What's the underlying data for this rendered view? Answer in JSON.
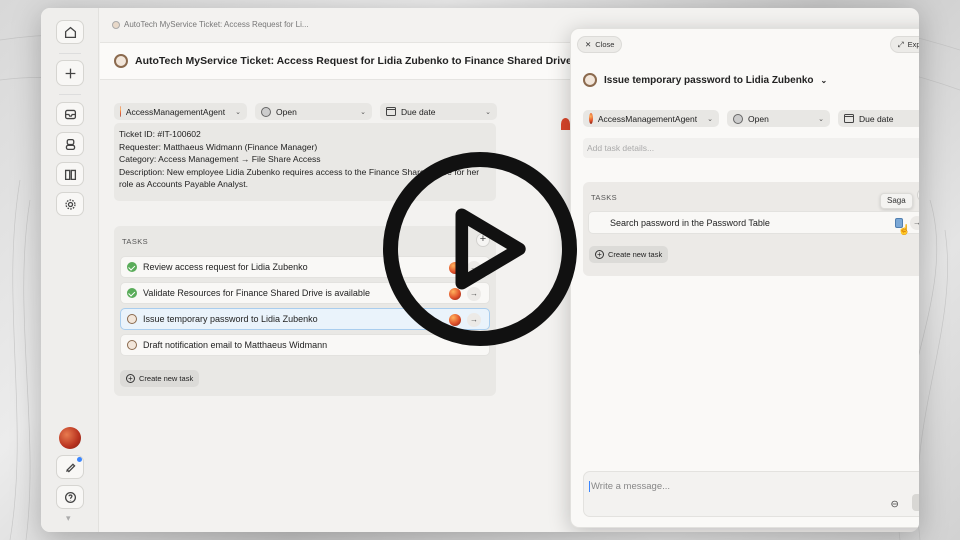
{
  "breadcrumb": "AutoTech MyService Ticket: Access Request for Li...",
  "ticket": {
    "title": "AutoTech MyService Ticket: Access Request for Lidia Zubenko to Finance Shared Drive",
    "agent": "AccessManagementAgent",
    "status": "Open",
    "due": "Due date",
    "description": [
      "Ticket ID: #IT-100602",
      "Requester: Matthaeus Widmann (Finance Manager)",
      "Category: Access Management → File Share Access",
      "Description: New employee Lidia Zubenko requires access to the Finance Shared Drive for her",
      "role as Accounts Payable Analyst."
    ],
    "tasks_header": "TASKS",
    "tasks": [
      {
        "label": "Review access request for Lidia Zubenko",
        "state": "done"
      },
      {
        "label": "Validate Resources for Finance Shared Drive is available",
        "state": "done"
      },
      {
        "label": "Issue temporary password to Lidia Zubenko",
        "state": "open"
      },
      {
        "label": "Draft notification email to Matthaeus Widmann",
        "state": "open"
      }
    ],
    "create_task": "Create new task"
  },
  "panel": {
    "close": "Close",
    "expand": "Expand",
    "title": "Issue temporary password to Lidia Zubenko",
    "agent": "AccessManagementAgent",
    "status": "Open",
    "due": "Due date",
    "details_placeholder": "Add task details...",
    "tasks_header": "TASKS",
    "subtask": "Search password in the Password Table",
    "tooltip": "Saga",
    "create_task": "Create new task",
    "message_placeholder": "Write a message..."
  },
  "icons": [
    "home-icon",
    "plus-icon",
    "inbox-icon",
    "agents-icon",
    "book-icon",
    "gear-icon",
    "bell-icon",
    "help-icon",
    "play-icon"
  ]
}
